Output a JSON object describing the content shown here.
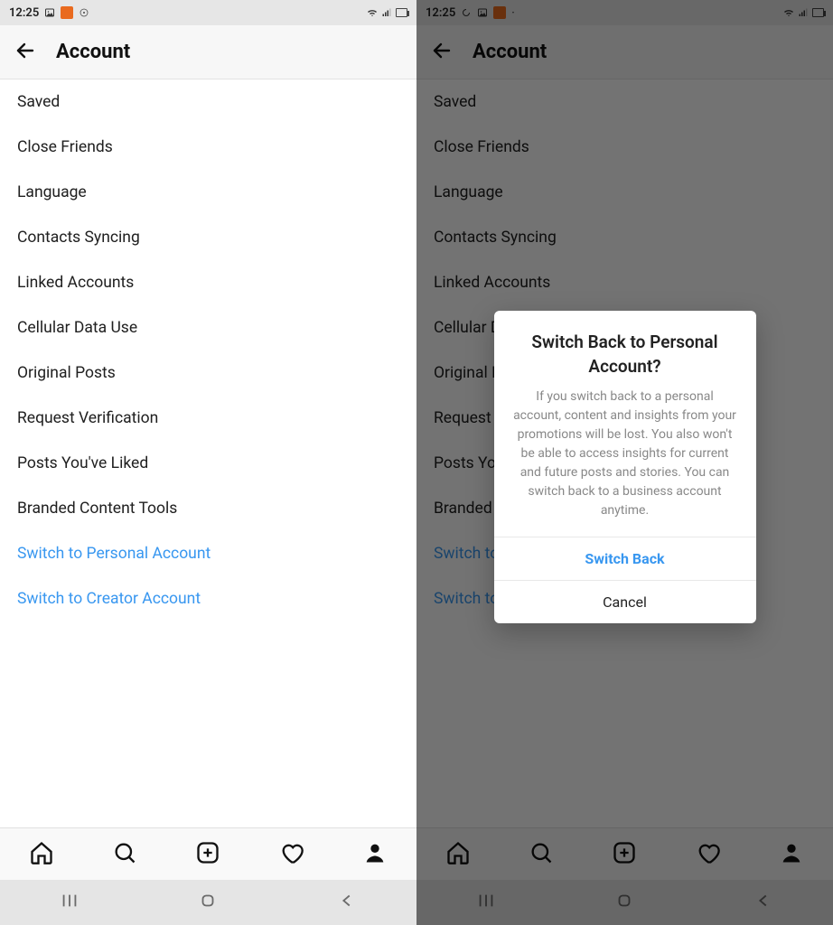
{
  "statusbar": {
    "time": "12:25"
  },
  "header": {
    "title": "Account"
  },
  "menu": {
    "items": [
      {
        "label": "Saved",
        "link": false
      },
      {
        "label": "Close Friends",
        "link": false
      },
      {
        "label": "Language",
        "link": false
      },
      {
        "label": "Contacts Syncing",
        "link": false
      },
      {
        "label": "Linked Accounts",
        "link": false
      },
      {
        "label": "Cellular Data Use",
        "link": false
      },
      {
        "label": "Original Posts",
        "link": false
      },
      {
        "label": "Request Verification",
        "link": false
      },
      {
        "label": "Posts You've Liked",
        "link": false
      },
      {
        "label": "Branded Content Tools",
        "link": false
      },
      {
        "label": "Switch to Personal Account",
        "link": true
      },
      {
        "label": "Switch to Creator Account",
        "link": true
      }
    ]
  },
  "dialog": {
    "title": "Switch Back to Personal Account?",
    "message": "If you switch back to a personal account, content and insights from your promotions will be lost. You also won't be able to access insights for current and future posts and stories. You can switch back to a business account anytime.",
    "primary": "Switch Back",
    "secondary": "Cancel"
  },
  "nav_icons": {
    "home": "home-icon",
    "search": "search-icon",
    "add": "add-post-icon",
    "activity": "heart-icon",
    "profile": "profile-icon"
  }
}
